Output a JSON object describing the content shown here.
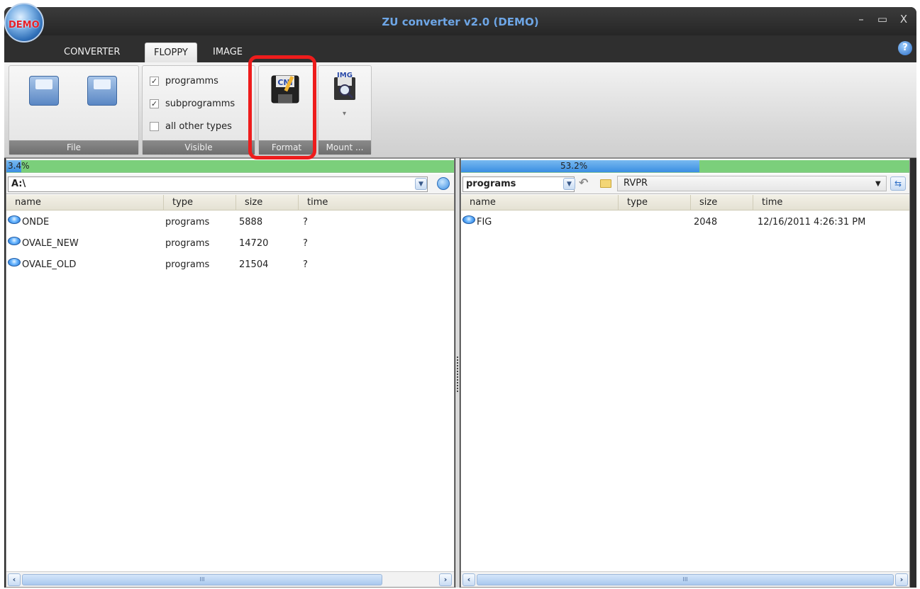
{
  "window": {
    "title": "ZU converter v2.0 (DEMO)",
    "orb_label": "DEMO",
    "controls": {
      "minimize": "–",
      "maximize": "▭",
      "close": "X"
    }
  },
  "tabs": [
    {
      "label": "CONVERTER",
      "active": false
    },
    {
      "label": "FLOPPY",
      "active": true
    },
    {
      "label": "IMAGE",
      "active": false
    }
  ],
  "help_icon": "?",
  "ribbon": {
    "groups": {
      "file": {
        "label": "File",
        "icons": [
          "floppy-open-icon",
          "floppy-save-icon"
        ]
      },
      "visible": {
        "label": "Visible",
        "checkboxes": [
          {
            "label": "programms",
            "checked": true
          },
          {
            "label": "subprogramms",
            "checked": true
          },
          {
            "label": "all other types",
            "checked": false
          }
        ]
      },
      "format": {
        "label": "Format",
        "icon": "format-floppy-icon",
        "icon_text": "CNI"
      },
      "mount": {
        "label": "Mount ...",
        "icon": "mount-image-icon",
        "icon_text": "IMG",
        "arrow": "▾"
      }
    }
  },
  "left_pane": {
    "usage": {
      "text": "3.4%",
      "fraction": 0.034
    },
    "path": "A:\\",
    "columns": [
      "name",
      "type",
      "size",
      "time"
    ],
    "rows": [
      {
        "name": "ONDE",
        "type": "programs",
        "size": "5888",
        "time": "?"
      },
      {
        "name": "OVALE_NEW",
        "type": "programs",
        "size": "14720",
        "time": "?"
      },
      {
        "name": "OVALE_OLD",
        "type": "programs",
        "size": "21504",
        "time": "?"
      }
    ]
  },
  "right_pane": {
    "usage": {
      "text": "53.2%",
      "fraction": 0.532
    },
    "filter": "programs",
    "folder": "RVPR",
    "columns": [
      "name",
      "type",
      "size",
      "time"
    ],
    "rows": [
      {
        "name": "FIG",
        "type": "",
        "size": "2048",
        "time": "12/16/2011 4:26:31 PM"
      }
    ]
  },
  "scroll": {
    "left": "‹",
    "right": "›",
    "thumb_grip": "III"
  },
  "colors": {
    "title_text": "#6ea6e6",
    "highlight": "#ee1c1c",
    "usage_green": "#7bcf7b",
    "usage_blue": "#3a8ee2"
  }
}
